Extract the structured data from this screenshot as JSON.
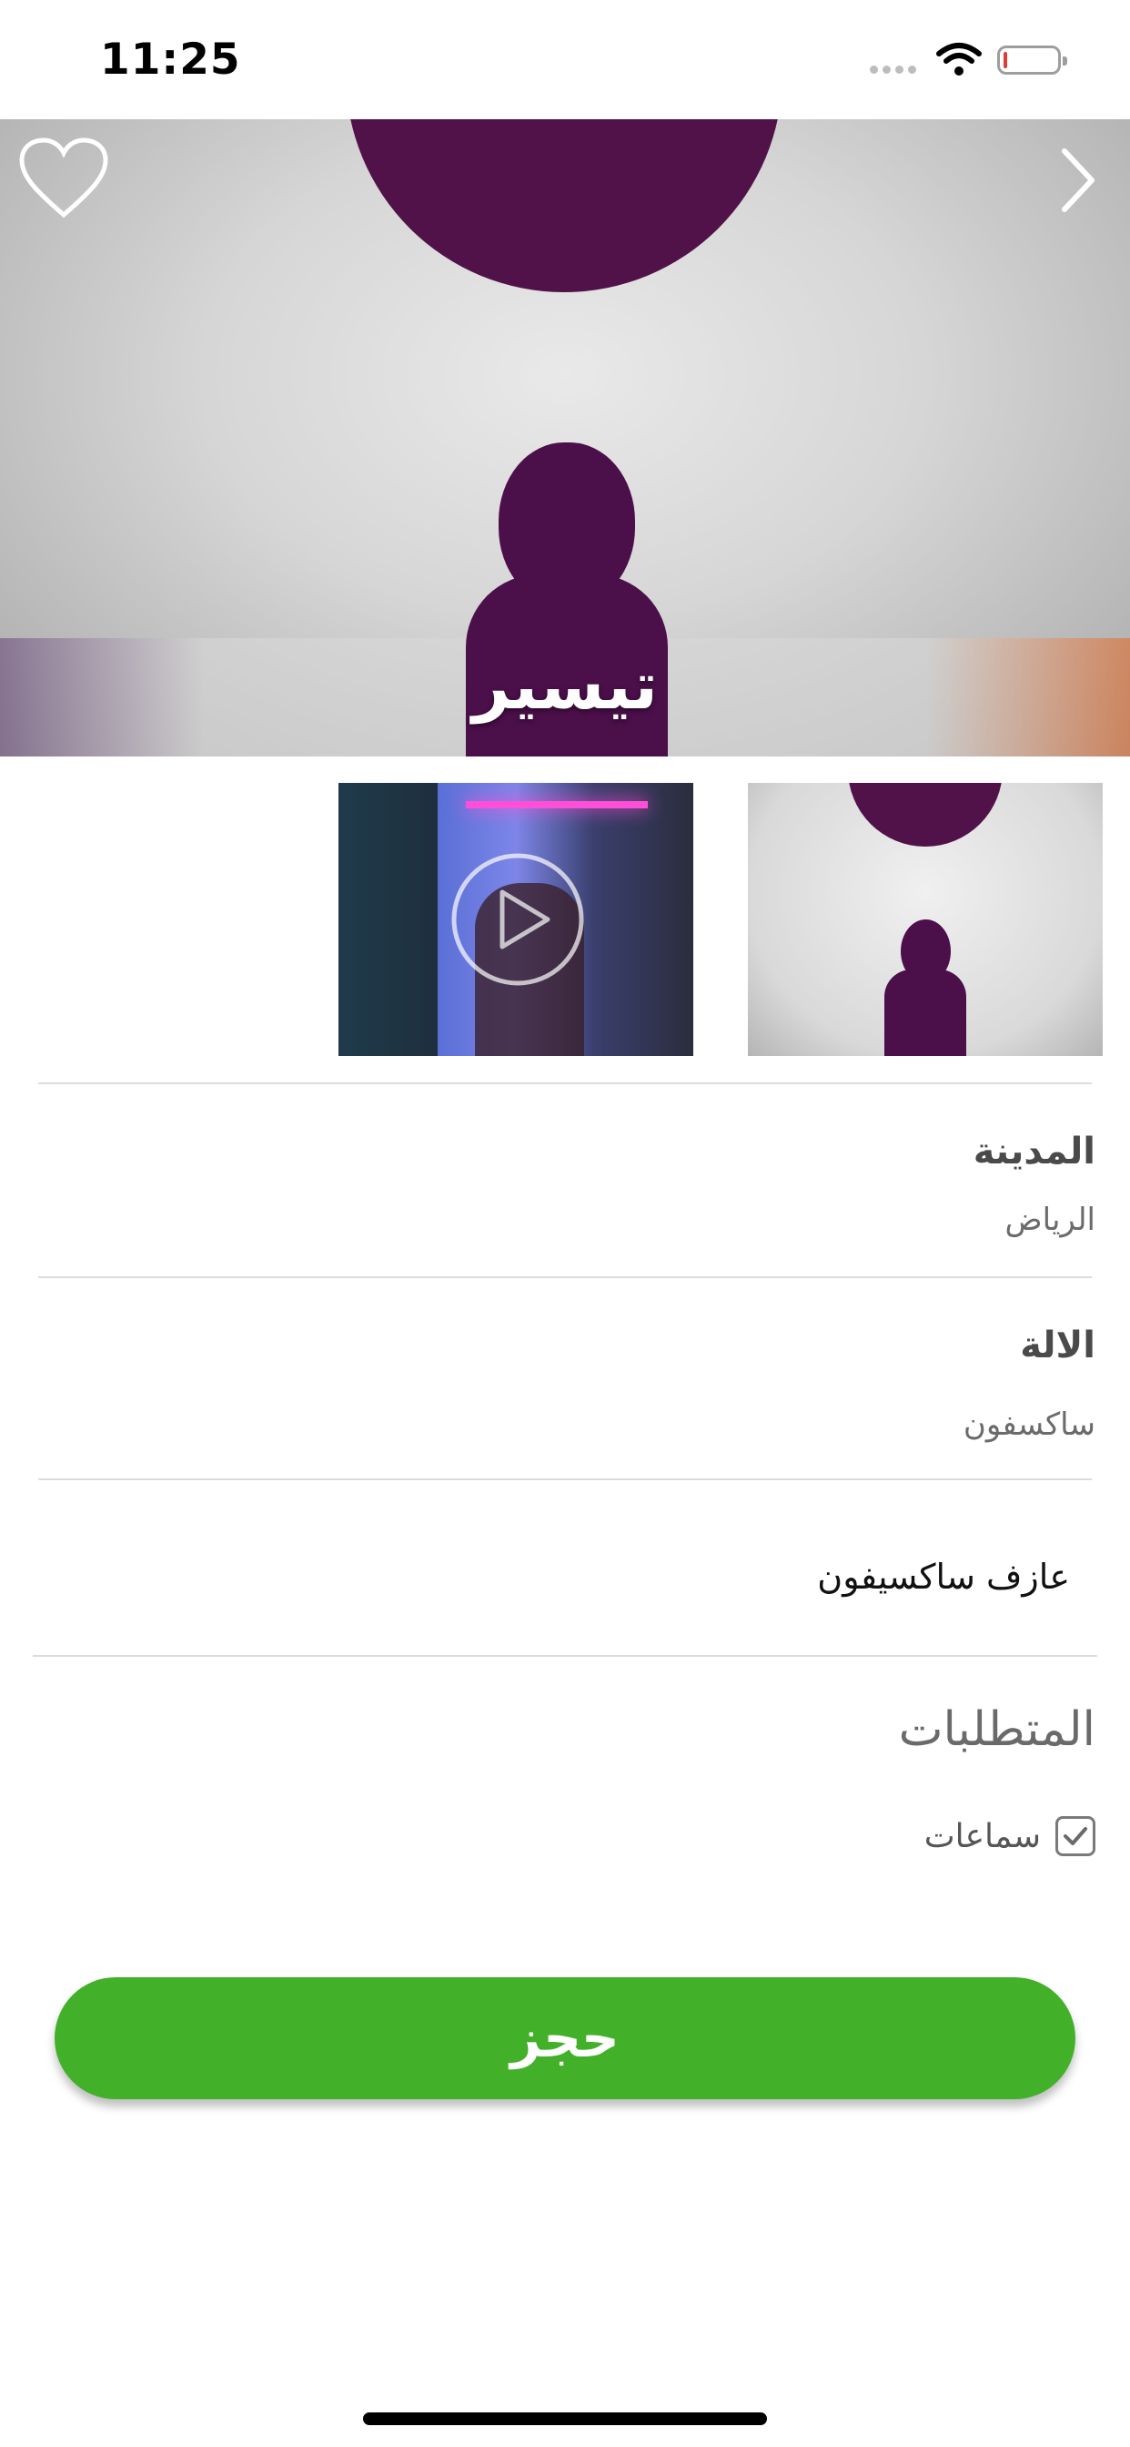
{
  "status_bar": {
    "time": "11:25",
    "battery_level": 0.05
  },
  "hero": {
    "title": "تيسير"
  },
  "thumbnails": [
    {
      "type": "photo"
    },
    {
      "type": "video",
      "icon": "play-icon"
    }
  ],
  "details": {
    "city_label": "المدينة",
    "city_value": "الرياض",
    "instrument_label": "الالة",
    "instrument_value": "ساكسفون",
    "description": "عازف ساكسيفون"
  },
  "requirements": {
    "title": "المتطلبات",
    "items": [
      {
        "label": "سماعات",
        "checked": true
      }
    ]
  },
  "book_button": {
    "label": "حجز",
    "color": "#43b02a"
  }
}
